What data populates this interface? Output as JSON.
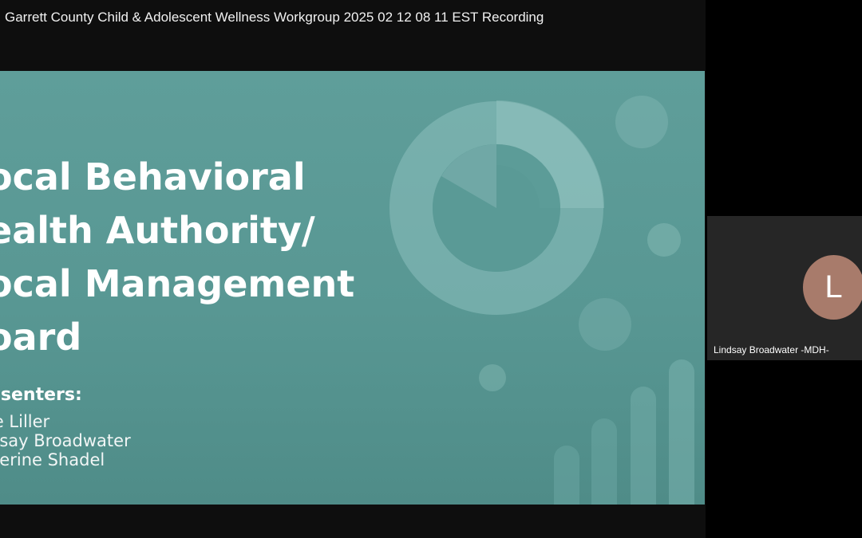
{
  "video": {
    "title": "Garrett County Child & Adolescent Wellness Workgroup 2025 02 12 08 11 EST Recording"
  },
  "slide": {
    "title_lines": [
      "ocal Behavioral",
      "ealth Authority/",
      "ocal Management",
      "oard"
    ],
    "presenters_heading": "esenters:",
    "presenters": [
      "ie Liller",
      "dsay Broadwater",
      "herine Shadel"
    ]
  },
  "participant": {
    "avatar_initial": "L",
    "name": "Lindsay Broadwater -MDH-"
  },
  "colors": {
    "slide_background": "#589793",
    "avatar_background": "#a87b6b",
    "tile_background": "#262626",
    "page_background": "#000000"
  }
}
